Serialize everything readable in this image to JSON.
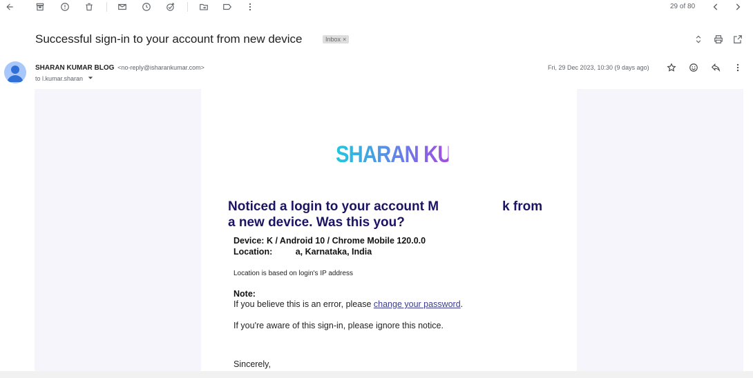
{
  "toolbar": {
    "icons": [
      "back-arrow-icon",
      "archive-icon",
      "report-spam-icon",
      "delete-icon",
      "mark-unread-icon",
      "snooze-icon",
      "add-task-icon",
      "move-to-icon",
      "label-icon",
      "more-vert-icon"
    ],
    "pager_text": "29 of 80"
  },
  "email": {
    "subject": "Successful sign-in to your account from new device",
    "label_chip": "Inbox",
    "label_close": "×",
    "sender_name": "SHARAN KUMAR BLOG",
    "sender_addr": "<no-reply@isharankumar.com>",
    "to_line": "to l.kumar.sharan",
    "date": "Fri, 29 Dec 2023, 10:30 (9 days ago)"
  },
  "body": {
    "logo_text": "SHARAN KUMAR",
    "headline_part1": "Noticed a login to your account M",
    "headline_part2": "k from a new device. Was this you?",
    "device_line": "Device: K / Android 10 / Chrome Mobile 120.0.0",
    "location_label": "Location:",
    "location_value": "a, Karnataka, India",
    "location_note": "Location is based on login's IP address",
    "note_title": "Note:",
    "note_text": "If you believe this is an error, please ",
    "note_link": "change your password",
    "note_end": ".",
    "aware_text": "If you're aware of this sign-in, please ignore this notice.",
    "signoff": "Sincerely,"
  },
  "colors": {
    "headline": "#1b1464",
    "logo_start": "#1fc8e0",
    "logo_end": "#e020c8",
    "page_bg": "#f6f5fc"
  }
}
